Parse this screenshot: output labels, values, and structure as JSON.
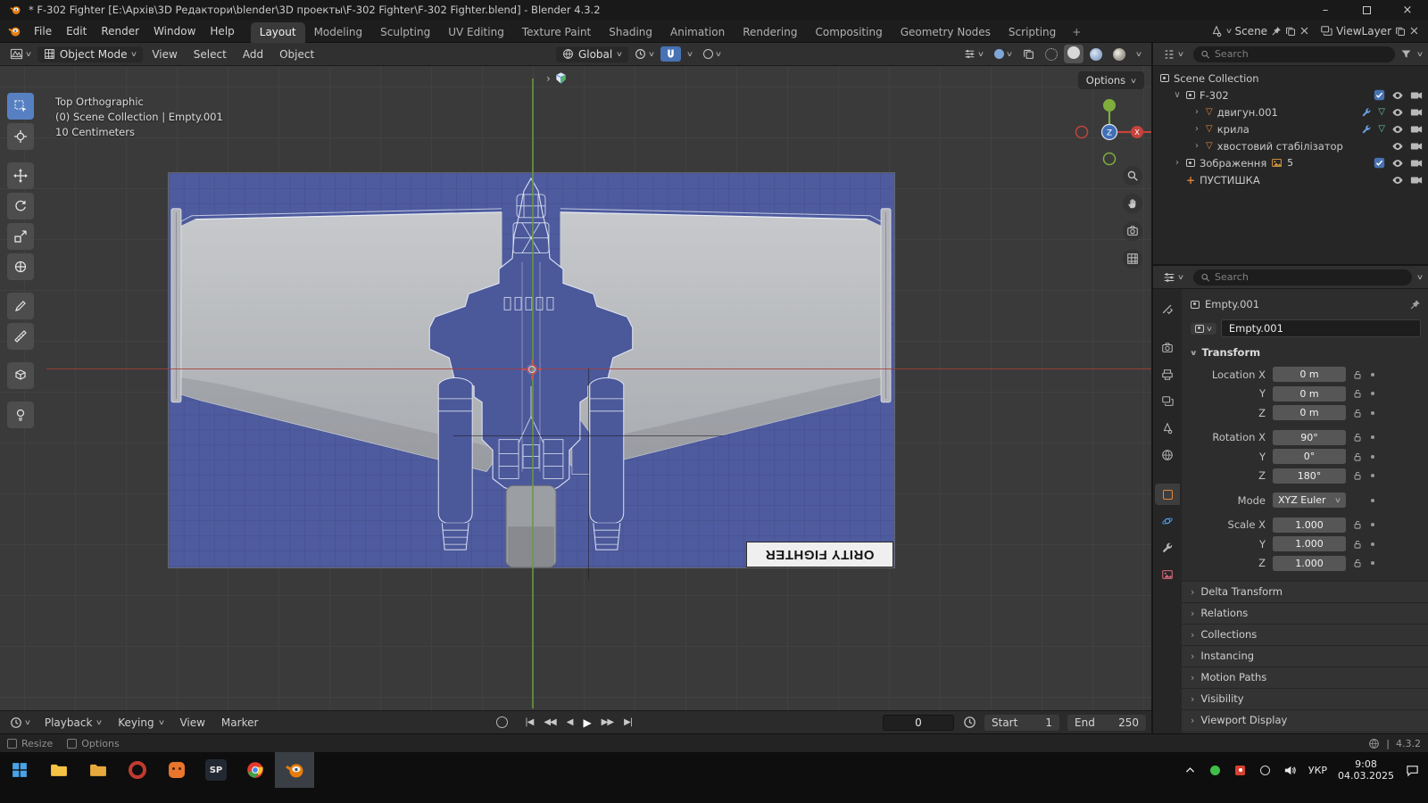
{
  "colors": {
    "accent_blue": "#4772b3",
    "blender_orange": "#e87d0d",
    "blueprint_blue": "#4e5b9e",
    "model_gray": "#b9bbbf",
    "axis_green": "#69983e",
    "axis_red": "#a53e3a"
  },
  "icons": {
    "minimize": "–",
    "close": "×",
    "caret": "∨",
    "expander_open": "∨",
    "expander_closed": "›",
    "mesh_triangle": "▽",
    "empty_plus": "+"
  },
  "titlebar": {
    "title": "* F-302 Fighter [E:\\Архів\\3D Редактори\\blender\\3D проекты\\F-302 Fighter\\F-302 Fighter.blend] - Blender 4.3.2"
  },
  "menubar": {
    "menus": [
      "File",
      "Edit",
      "Render",
      "Window",
      "Help"
    ],
    "tabs": [
      "Layout",
      "Modeling",
      "Sculpting",
      "UV Editing",
      "Texture Paint",
      "Shading",
      "Animation",
      "Rendering",
      "Compositing",
      "Geometry Nodes",
      "Scripting"
    ],
    "add_tab": "+",
    "scene_label": "Scene",
    "viewlayer_label": "ViewLayer"
  },
  "toolheader": {
    "mode": "Object Mode",
    "menus": [
      "View",
      "Select",
      "Add",
      "Object"
    ],
    "orientation": "Global"
  },
  "viewport": {
    "view_label": "Top Orthographic",
    "context_label": "(0) Scene Collection | Empty.001",
    "scale_label": "10 Centimeters",
    "options_label": "Options",
    "blueprint_caption": "ORITY FIGHTER",
    "gizmo": {
      "x": "X",
      "z": "Z"
    },
    "tools": [
      "select-box",
      "cursor",
      "move",
      "rotate",
      "scale",
      "transform",
      "annotate",
      "measure",
      "add-cube",
      "add-light"
    ]
  },
  "outliner": {
    "search_placeholder": "Search",
    "rows": [
      {
        "label": "Scene Collection"
      },
      {
        "label": "F-302"
      },
      {
        "label": "двигун.001"
      },
      {
        "label": "крила"
      },
      {
        "label": "хвостовий стабілізатор"
      },
      {
        "label": "Зображення",
        "badge": "5"
      },
      {
        "label": "ПУСТИШКА"
      }
    ]
  },
  "properties": {
    "search_placeholder": "Search",
    "breadcrumb": "Empty.001",
    "name_value": "Empty.001",
    "transform_title": "Transform",
    "rows": [
      {
        "label": "Location X",
        "value": "0 m"
      },
      {
        "label": "Y",
        "value": "0 m"
      },
      {
        "label": "Z",
        "value": "0 m"
      },
      {
        "label": "Rotation X",
        "value": "90°"
      },
      {
        "label": "Y",
        "value": "0°"
      },
      {
        "label": "Z",
        "value": "180°"
      },
      {
        "label": "Mode",
        "value": "XYZ Euler"
      },
      {
        "label": "Scale X",
        "value": "1.000"
      },
      {
        "label": "Y",
        "value": "1.000"
      },
      {
        "label": "Z",
        "value": "1.000"
      }
    ],
    "sections": [
      "Delta Transform",
      "Relations",
      "Collections",
      "Instancing",
      "Motion Paths",
      "Visibility",
      "Viewport Display"
    ]
  },
  "timeline": {
    "menus": [
      "Playback",
      "Keying",
      "View",
      "Marker"
    ],
    "frame": "0",
    "start_label": "Start",
    "start_value": "1",
    "end_label": "End",
    "end_value": "250",
    "transport": {
      "jump_start": "|◀",
      "prev_key": "◀◀",
      "play_rev": "◀",
      "play": "▶",
      "next_key": "▶▶",
      "jump_end": "▶|"
    }
  },
  "statusbar": {
    "resize_label": "Resize",
    "options_label": "Options",
    "version": "4.3.2"
  },
  "taskbar": {
    "sp_label": "SP",
    "language": "УКР",
    "time": "9:08",
    "date": "04.03.2025"
  }
}
